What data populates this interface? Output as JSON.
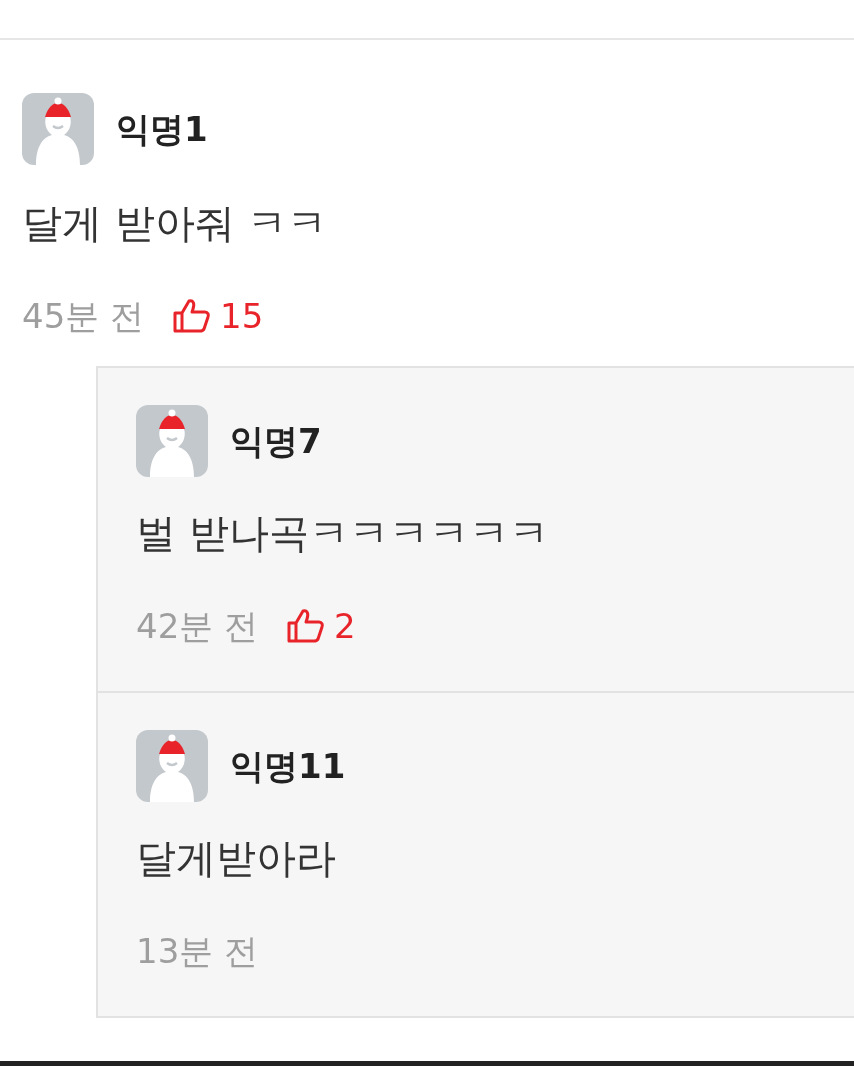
{
  "comments": [
    {
      "name": "익명1",
      "text": "달게 받아줘 ㅋㅋ",
      "time": "45분 전",
      "likes": "15",
      "replies": [
        {
          "name": "익명7",
          "text": "벌 받나곡ㅋㅋㅋㅋㅋㅋ",
          "time": "42분 전",
          "likes": "2"
        },
        {
          "name": "익명11",
          "text": "달게받아라",
          "time": "13분 전"
        }
      ]
    }
  ]
}
